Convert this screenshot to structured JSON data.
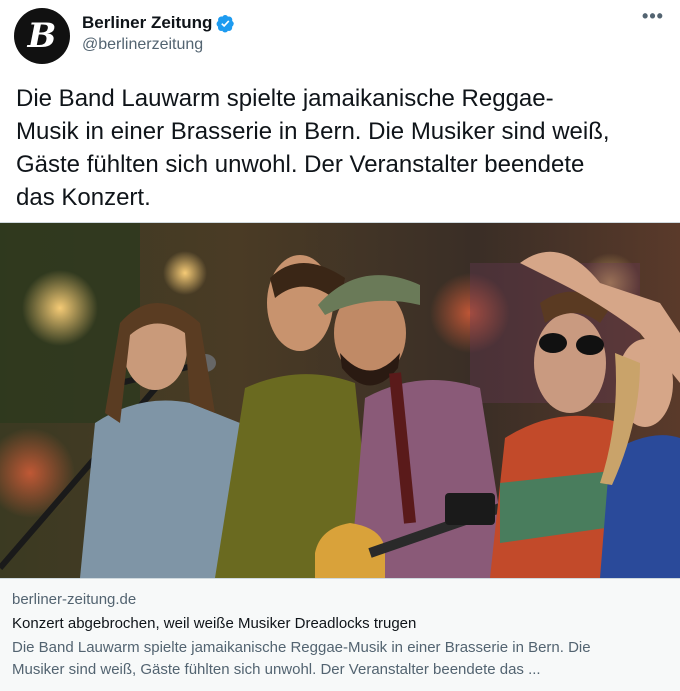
{
  "account": {
    "display_name": "Berliner Zeitung",
    "handle": "@berlinerzeitung",
    "avatar_letter": "B",
    "verified": true,
    "verified_color": "#1d9bf0"
  },
  "more_label": "•••",
  "tweet": {
    "text": "Die Band Lauwarm spielte jamaikanische Reggae-\nMusik in einer Brasserie in Bern. Die Musiker sind weiß,\nGäste fühlten sich unwohl. Der Veranstalter beendete\ndas Konzert."
  },
  "card": {
    "domain": "berliner-zeitung.de",
    "title": "Konzert abgebrochen, weil weiße Musiker Dreadlocks trugen",
    "description_line1": "Die Band Lauwarm spielte jamaikanische Reggae-Musik in einer Brasserie in Bern. Die",
    "description_line2": "Musiker sind weiß, Gäste fühlten sich unwohl. Der Veranstalter beendete das ..."
  },
  "colors": {
    "text_primary": "#0f1419",
    "text_secondary": "#536471",
    "border": "#cfd9de",
    "card_meta_bg": "#f7f9f9"
  }
}
